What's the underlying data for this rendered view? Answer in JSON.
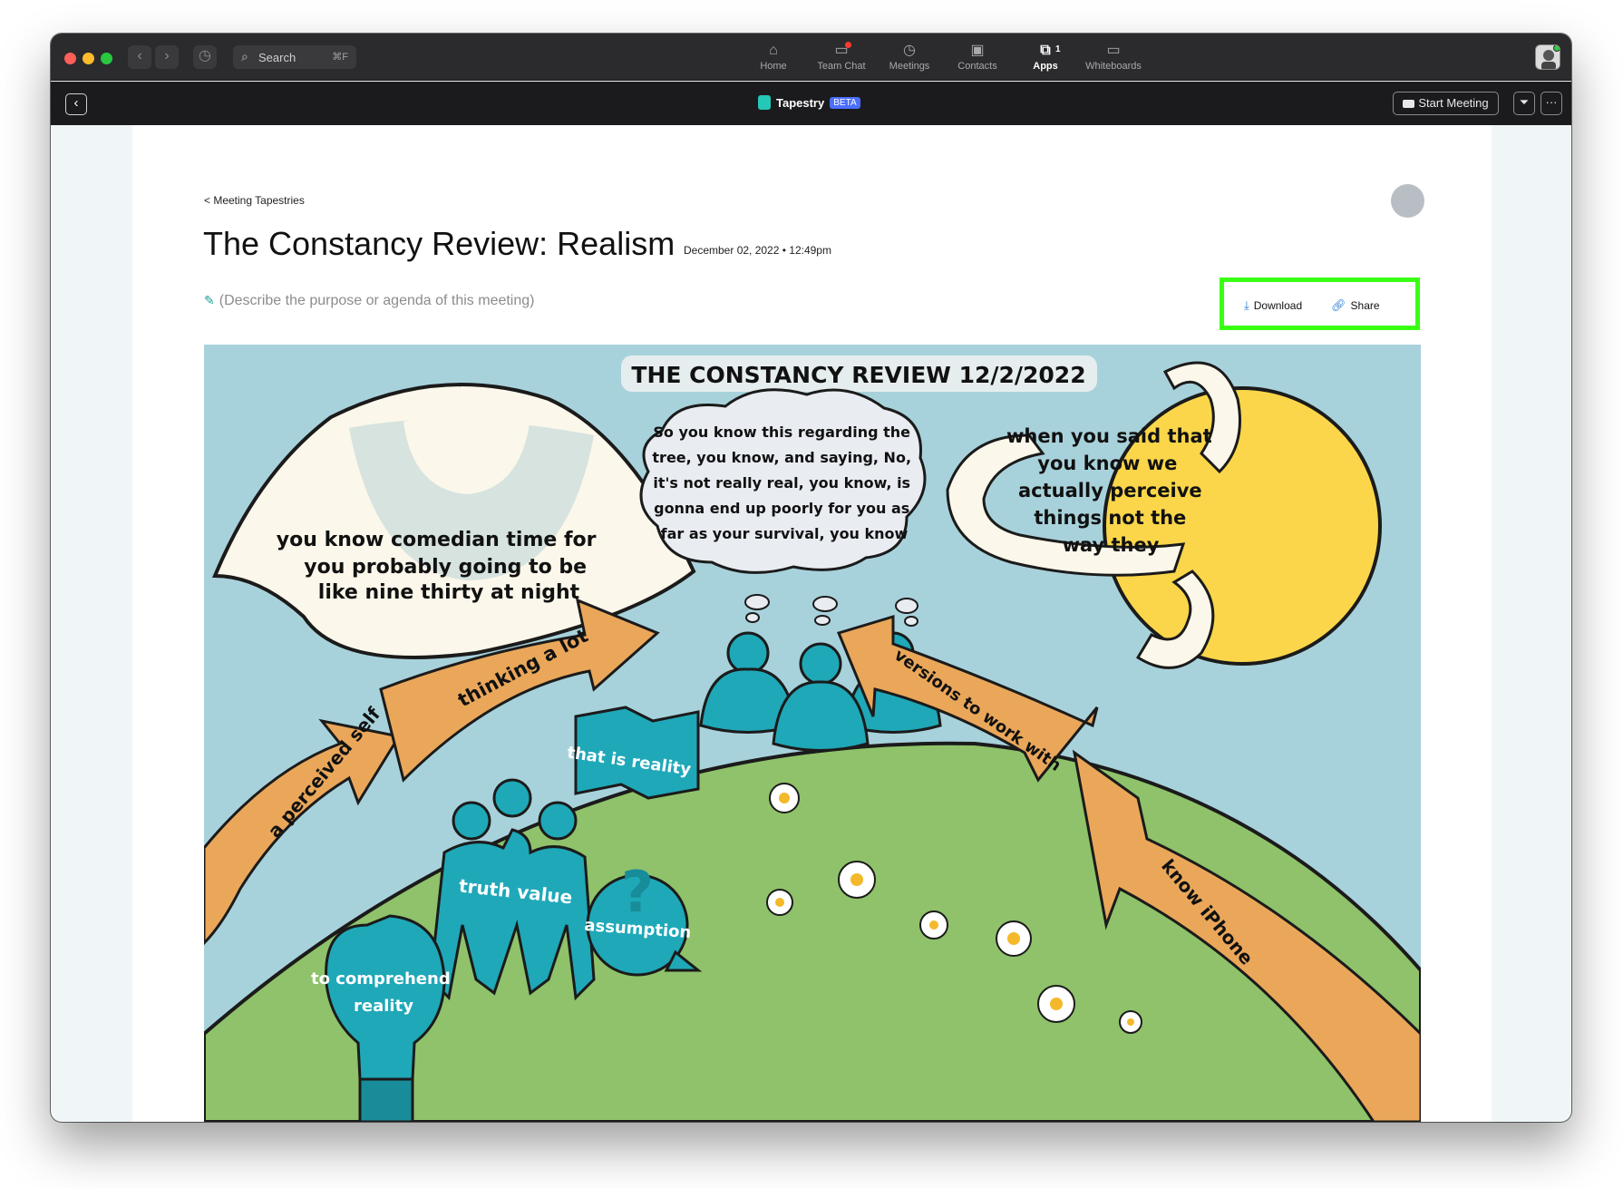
{
  "titlebar": {
    "search_label": "Search",
    "search_shortcut": "⌘F",
    "tabs": [
      {
        "label": "Home",
        "icon": "home-icon"
      },
      {
        "label": "Team Chat",
        "icon": "chat-icon"
      },
      {
        "label": "Meetings",
        "icon": "clock-icon"
      },
      {
        "label": "Contacts",
        "icon": "contacts-icon"
      },
      {
        "label": "Apps",
        "icon": "apps-icon",
        "badge": "1",
        "active": true
      },
      {
        "label": "Whiteboards",
        "icon": "whiteboard-icon"
      }
    ]
  },
  "app_toolbar": {
    "app_name": "Tapestry",
    "beta_label": "BETA",
    "start_meeting_label": "Start Meeting"
  },
  "page": {
    "breadcrumb": "< Meeting Tapestries",
    "title": "The Constancy Review: Realism",
    "date": "December 02, 2022 • 12:49pm",
    "description_placeholder": "(Describe the purpose or agenda of this meeting)",
    "download_label": "Download",
    "share_label": "Share",
    "highlight_color": "#39ff14"
  },
  "tapestry": {
    "heading": "THE CONSTANCY REVIEW 12/2/2022",
    "eye_text": [
      "you know comedian time for",
      "you probably going to be",
      "like nine thirty at night"
    ],
    "cloud_text": [
      "So you know this regarding the",
      "tree, you know, and saying, No,",
      "it's not really real, you know, is",
      "gonna end up poorly for you as",
      "far as your survival, you know"
    ],
    "sun_text": [
      "when you said that",
      "you know we",
      "actually perceive",
      "things not the",
      "way they"
    ],
    "arrow_thinking": "thinking a lot",
    "arrow_perceived": "a perceived self",
    "arrow_versions": "versions to work with",
    "arrow_iphone": "know iPhone",
    "map_label": "that is reality",
    "group_label": "truth value",
    "bubble_label": "assumption",
    "bulb_label": [
      "to comprehend",
      "reality"
    ]
  }
}
